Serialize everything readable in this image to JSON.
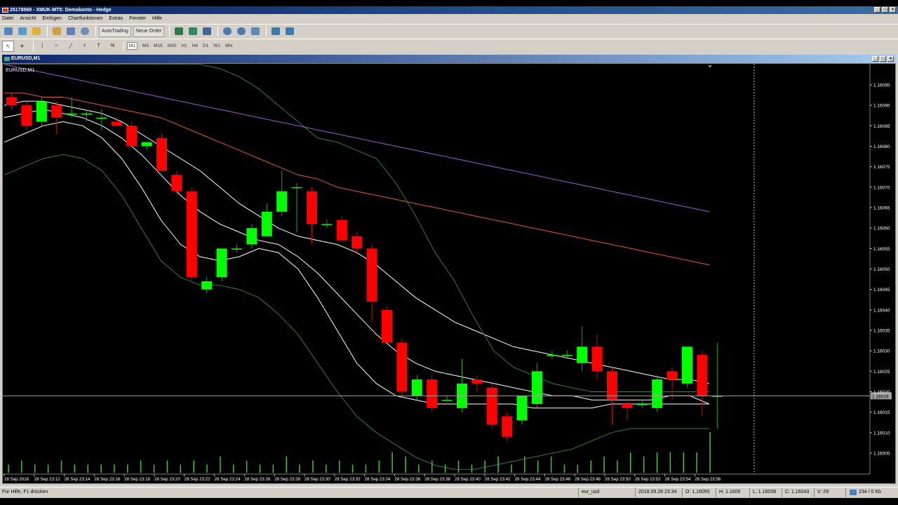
{
  "app": {
    "title": "25178569 - XMUK-MT5: Demokonto - Hedge",
    "window_buttons": [
      "_",
      "□",
      "×"
    ]
  },
  "menu": [
    "Datei",
    "Ansicht",
    "Einfügen",
    "Chartfunktionen",
    "Extras",
    "Fenster",
    "Hilfe"
  ],
  "toolbar1": {
    "autotrading_label": "AutoTrading",
    "new_order_label": "Neue Order"
  },
  "timeframes": [
    "M1",
    "M5",
    "M15",
    "M30",
    "H1",
    "H4",
    "D1",
    "W1",
    "MN"
  ],
  "active_timeframe": "M1",
  "chart_window": {
    "title": "EURUSD,M1",
    "label": "EURUSD,M1",
    "current_price_label": "1.16019"
  },
  "status": {
    "help": "Für Hilfe, F1 drücken",
    "profile": "eur_usd",
    "datetime": "2018.09.28 23:34",
    "open": "O: 1.16055",
    "high": "H: 1.1605",
    "low": "L: 1.16038",
    "close": "C: 1.16043",
    "volume": "V: 29",
    "traffic": "234 / 0 Kb"
  },
  "colors": {
    "bull": "#00ff00",
    "bear": "#ff0000",
    "background": "#000000",
    "ma_white": "#ffffff",
    "ma_orange": "#e05a2a",
    "ma_purple": "#9b59d0",
    "ma_green": "#3a7a3a"
  },
  "chart_data": {
    "type": "candlestick",
    "symbol": "EURUSD",
    "timeframe": "M1",
    "y_ticks": [
      "1.16095",
      "1.16090",
      "1.16085",
      "1.16080",
      "1.16075",
      "1.16070",
      "1.16065",
      "1.16060",
      "1.16055",
      "1.16050",
      "1.16045",
      "1.16040",
      "1.16035",
      "1.16030",
      "1.16025",
      "1.16020",
      "1.16015",
      "1.16010",
      "1.16005"
    ],
    "x_tick_labels": [
      "28 Sep 2018",
      "28 Sep 23:12",
      "28 Sep 23:14",
      "28 Sep 23:16",
      "28 Sep 23:18",
      "28 Sep 23:20",
      "28 Sep 23:22",
      "28 Sep 23:24",
      "28 Sep 23:26",
      "28 Sep 23:28",
      "28 Sep 23:30",
      "28 Sep 23:32",
      "28 Sep 23:34",
      "28 Sep 23:36",
      "28 Sep 23:38",
      "28 Sep 23:40",
      "28 Sep 23:42",
      "28 Sep 23:44",
      "28 Sep 23:46",
      "28 Sep 23:48",
      "28 Sep 23:50",
      "28 Sep 23:52",
      "28 Sep 23:54",
      "28 Sep 23:56"
    ],
    "ylim": [
      1.16,
      1.161
    ],
    "current_price": 1.16019,
    "candles": [
      {
        "o": 1.16092,
        "h": 1.16093,
        "l": 1.16089,
        "c": 1.1609
      },
      {
        "o": 1.1609,
        "h": 1.16091,
        "l": 1.16084,
        "c": 1.16085
      },
      {
        "o": 1.16086,
        "h": 1.16092,
        "l": 1.16085,
        "c": 1.16091
      },
      {
        "o": 1.1609,
        "h": 1.16091,
        "l": 1.16083,
        "c": 1.16087
      },
      {
        "o": 1.16088,
        "h": 1.16092,
        "l": 1.16087,
        "c": 1.16088
      },
      {
        "o": 1.16088,
        "h": 1.16089,
        "l": 1.16086,
        "c": 1.16088
      },
      {
        "o": 1.16087,
        "h": 1.16089,
        "l": 1.16084,
        "c": 1.16087
      },
      {
        "o": 1.16086,
        "h": 1.16087,
        "l": 1.16085,
        "c": 1.16085
      },
      {
        "o": 1.16085,
        "h": 1.16086,
        "l": 1.1608,
        "c": 1.1608
      },
      {
        "o": 1.1608,
        "h": 1.16081,
        "l": 1.16079,
        "c": 1.16081
      },
      {
        "o": 1.16082,
        "h": 1.16083,
        "l": 1.16074,
        "c": 1.16074
      },
      {
        "o": 1.16073,
        "h": 1.16074,
        "l": 1.16068,
        "c": 1.16069
      },
      {
        "o": 1.16069,
        "h": 1.1607,
        "l": 1.16047,
        "c": 1.16048
      },
      {
        "o": 1.16045,
        "h": 1.16048,
        "l": 1.16044,
        "c": 1.16047
      },
      {
        "o": 1.16048,
        "h": 1.16055,
        "l": 1.16047,
        "c": 1.16055
      },
      {
        "o": 1.16055,
        "h": 1.16056,
        "l": 1.16054,
        "c": 1.16055
      },
      {
        "o": 1.16056,
        "h": 1.16061,
        "l": 1.16055,
        "c": 1.1606
      },
      {
        "o": 1.16058,
        "h": 1.16066,
        "l": 1.16058,
        "c": 1.16064
      },
      {
        "o": 1.16064,
        "h": 1.16074,
        "l": 1.16063,
        "c": 1.16069
      },
      {
        "o": 1.1607,
        "h": 1.16071,
        "l": 1.16059,
        "c": 1.1607
      },
      {
        "o": 1.16069,
        "h": 1.1607,
        "l": 1.16056,
        "c": 1.16061
      },
      {
        "o": 1.16061,
        "h": 1.16062,
        "l": 1.1606,
        "c": 1.16061
      },
      {
        "o": 1.16062,
        "h": 1.16063,
        "l": 1.16057,
        "c": 1.16057
      },
      {
        "o": 1.16058,
        "h": 1.16059,
        "l": 1.16054,
        "c": 1.16055
      },
      {
        "o": 1.16055,
        "h": 1.16056,
        "l": 1.16037,
        "c": 1.16042
      },
      {
        "o": 1.1604,
        "h": 1.16041,
        "l": 1.16032,
        "c": 1.16032
      },
      {
        "o": 1.16032,
        "h": 1.16033,
        "l": 1.16019,
        "c": 1.1602
      },
      {
        "o": 1.16019,
        "h": 1.16024,
        "l": 1.16018,
        "c": 1.16023
      },
      {
        "o": 1.16023,
        "h": 1.16024,
        "l": 1.16015,
        "c": 1.16016
      },
      {
        "o": 1.16018,
        "h": 1.16019,
        "l": 1.16018,
        "c": 1.16018
      },
      {
        "o": 1.16016,
        "h": 1.16028,
        "l": 1.16015,
        "c": 1.16022
      },
      {
        "o": 1.16023,
        "h": 1.16024,
        "l": 1.1602,
        "c": 1.16022
      },
      {
        "o": 1.16021,
        "h": 1.16022,
        "l": 1.16011,
        "c": 1.16012
      },
      {
        "o": 1.16014,
        "h": 1.16015,
        "l": 1.16008,
        "c": 1.16009
      },
      {
        "o": 1.16013,
        "h": 1.16019,
        "l": 1.16012,
        "c": 1.16019
      },
      {
        "o": 1.16017,
        "h": 1.16027,
        "l": 1.16016,
        "c": 1.16025
      },
      {
        "o": 1.16029,
        "h": 1.1603,
        "l": 1.16028,
        "c": 1.16029
      },
      {
        "o": 1.16029,
        "h": 1.1603,
        "l": 1.16028,
        "c": 1.16029
      },
      {
        "o": 1.16027,
        "h": 1.16036,
        "l": 1.16025,
        "c": 1.16031
      },
      {
        "o": 1.16031,
        "h": 1.16034,
        "l": 1.16023,
        "c": 1.16025
      },
      {
        "o": 1.16025,
        "h": 1.16026,
        "l": 1.16012,
        "c": 1.16018
      },
      {
        "o": 1.16017,
        "h": 1.16018,
        "l": 1.16013,
        "c": 1.16016
      },
      {
        "o": 1.16017,
        "h": 1.16018,
        "l": 1.16016,
        "c": 1.16017
      },
      {
        "o": 1.16016,
        "h": 1.16024,
        "l": 1.16015,
        "c": 1.16023
      },
      {
        "o": 1.16025,
        "h": 1.16026,
        "l": 1.16018,
        "c": 1.16023
      },
      {
        "o": 1.16022,
        "h": 1.16031,
        "l": 1.16021,
        "c": 1.16031
      },
      {
        "o": 1.16029,
        "h": 1.1603,
        "l": 1.16014,
        "c": 1.16019
      },
      {
        "o": 1.16019,
        "h": 1.16032,
        "l": 1.16011,
        "c": 1.16019
      }
    ],
    "volumes": [
      2,
      3,
      2,
      2,
      3,
      2,
      2,
      2,
      2,
      2,
      3,
      2,
      3,
      2,
      3,
      2,
      4,
      2,
      3,
      2,
      2,
      4,
      2,
      3,
      2,
      3,
      2,
      2,
      3,
      5,
      4,
      2,
      3,
      2,
      3,
      2,
      3,
      4,
      2,
      4,
      3,
      4,
      2,
      2,
      3,
      4,
      3,
      5,
      4,
      5,
      5,
      5,
      5,
      10
    ],
    "moving_averages": [
      {
        "color": "#ffffff",
        "values": [
          1.1609,
          1.16091,
          1.16091,
          1.1609,
          1.16089,
          1.16088,
          1.16086,
          1.16083,
          1.1608,
          1.16077,
          1.16074,
          1.1607,
          1.16066,
          1.16063,
          1.1606,
          1.16058,
          1.16057,
          1.16056,
          1.16054,
          1.16051,
          1.16047,
          1.16043,
          1.1604,
          1.16037,
          1.16035,
          1.16033,
          1.16031,
          1.1603,
          1.16029,
          1.16028,
          1.16027,
          1.16026,
          1.16025,
          1.16024,
          1.16023,
          1.16023,
          1.16022
        ]
      },
      {
        "color": "#ffffff",
        "values": [
          1.16087,
          1.16088,
          1.16089,
          1.16088,
          1.16087,
          1.16085,
          1.16082,
          1.16078,
          1.16073,
          1.16068,
          1.16064,
          1.16061,
          1.16059,
          1.16057,
          1.16056,
          1.16053,
          1.16049,
          1.16044,
          1.16039,
          1.16034,
          1.1603,
          1.16027,
          1.16025,
          1.16024,
          1.16023,
          1.16022,
          1.16021,
          1.1602,
          1.16019,
          1.16019,
          1.16018,
          1.16018,
          1.16018,
          1.16018,
          1.16019,
          1.16019,
          1.16017
        ]
      },
      {
        "color": "#ffffff",
        "values": [
          1.16081,
          1.16083,
          1.16085,
          1.16086,
          1.16085,
          1.16082,
          1.16077,
          1.1607,
          1.16062,
          1.16056,
          1.16053,
          1.16052,
          1.16053,
          1.16055,
          1.16054,
          1.1605,
          1.16043,
          1.16035,
          1.16027,
          1.16022,
          1.16019,
          1.16018,
          1.16017,
          1.16017,
          1.16017,
          1.16017,
          1.16017,
          1.16016,
          1.16016,
          1.16016,
          1.16016,
          1.16017,
          1.16017,
          1.16017,
          1.16017,
          1.16017,
          1.16017
        ]
      },
      {
        "color": "#3a7a3a",
        "values": [
          1.16073,
          1.16075,
          1.16077,
          1.16078,
          1.16077,
          1.16074,
          1.16068,
          1.1606,
          1.16052,
          1.16048,
          1.16046,
          1.16046,
          1.16045,
          1.16043,
          1.16039,
          1.16034,
          1.16027,
          1.1602,
          1.16014,
          1.1601,
          1.16007,
          1.16004,
          1.16002,
          1.16001,
          1.16001,
          1.16002,
          1.16003,
          1.16004,
          1.16005,
          1.16006,
          1.16008,
          1.1601,
          1.16011,
          1.16011,
          1.16011,
          1.16011,
          1.16011
        ]
      },
      {
        "color": "#3a7a3a",
        "values": [
          1.161,
          1.161,
          1.161,
          1.161,
          1.161,
          1.161,
          1.161,
          1.161,
          1.161,
          1.161,
          1.161,
          1.16099,
          1.16097,
          1.16094,
          1.1609,
          1.16086,
          1.16082,
          1.16081,
          1.16079,
          1.16077,
          1.16071,
          1.16063,
          1.16054,
          1.16047,
          1.16038,
          1.1603,
          1.16026,
          1.16024,
          1.16022,
          1.16021,
          1.1602,
          1.1602,
          1.1602,
          1.1602,
          1.1602,
          1.1602,
          1.1602
        ]
      },
      {
        "color": "#e05a2a",
        "values": [
          1.16093,
          1.16093,
          1.16092,
          1.16092,
          1.16091,
          1.1609,
          1.16089,
          1.16088,
          1.16087,
          1.16085,
          1.16083,
          1.16081,
          1.16079,
          1.16077,
          1.16075,
          1.16073,
          1.16072,
          1.1607,
          1.16069,
          1.16068,
          1.16067,
          1.16066,
          1.16065,
          1.16064,
          1.16063,
          1.16062,
          1.16061,
          1.1606,
          1.16059,
          1.16058,
          1.16057,
          1.16056,
          1.16055,
          1.16054,
          1.16053,
          1.16052,
          1.16051
        ]
      },
      {
        "color": "#9b59d0",
        "values": [
          1.161,
          1.16099,
          1.16098,
          1.16097,
          1.16096,
          1.16095,
          1.16094,
          1.16093,
          1.16092,
          1.16091,
          1.1609,
          1.16089,
          1.16088,
          1.16087,
          1.16086,
          1.16085,
          1.16084,
          1.16083,
          1.16082,
          1.16081,
          1.1608,
          1.16079,
          1.16078,
          1.16077,
          1.16076,
          1.16075,
          1.16074,
          1.16073,
          1.16072,
          1.16071,
          1.1607,
          1.16069,
          1.16068,
          1.16067,
          1.16066,
          1.16065,
          1.16064
        ]
      }
    ]
  }
}
